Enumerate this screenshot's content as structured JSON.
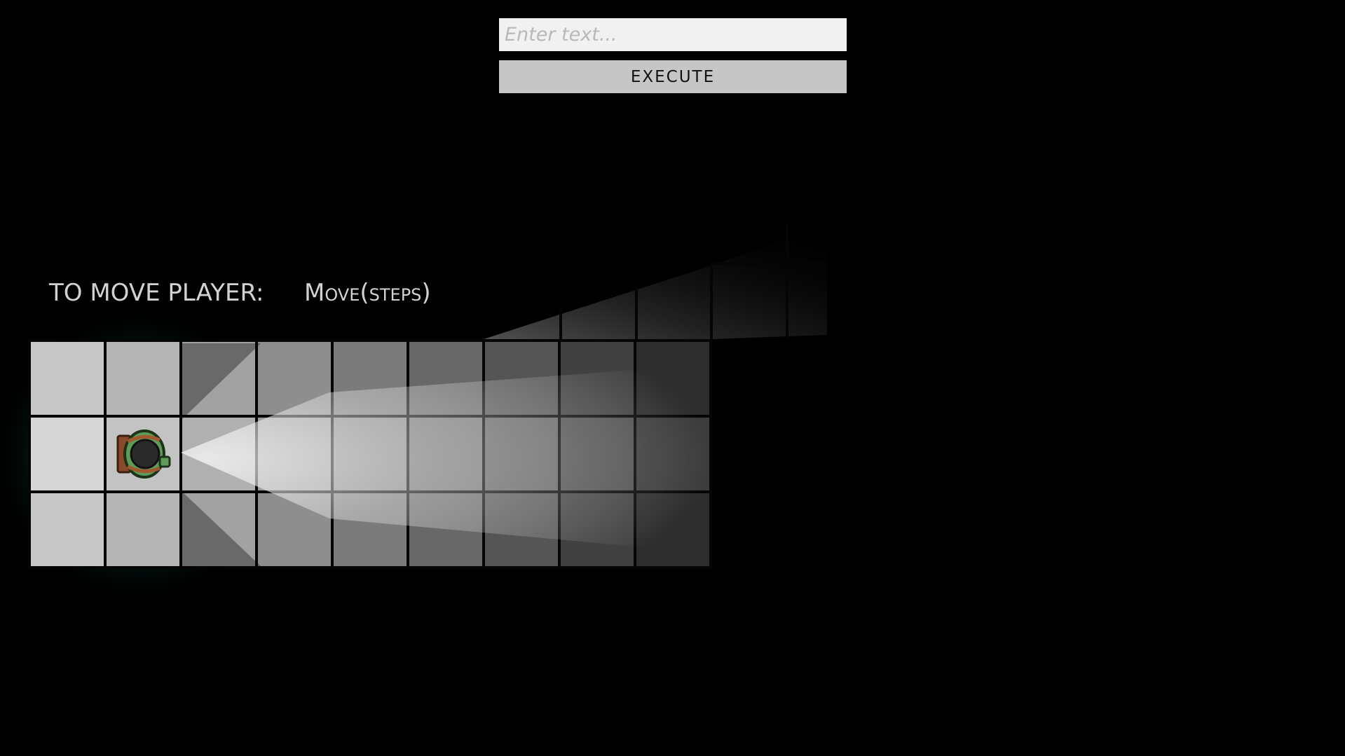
{
  "console": {
    "input_value": "",
    "input_placeholder": "Enter text...",
    "execute_label": "EXECUTE"
  },
  "instructions": {
    "label": "TO MOVE PLAYER:",
    "command": "Move(steps)"
  },
  "board": {
    "columns": 9,
    "rows": 3,
    "player": {
      "row": 1,
      "column": 1,
      "facing": "right"
    }
  },
  "colors": {
    "background": "#000000",
    "tile_bright": "#d9d9d9",
    "tile_dark": "#2f2f2f",
    "grid_line": "#050505",
    "glow": "#1e8a80",
    "player_body": "#5f9a58",
    "player_back": "#8a4a2a"
  },
  "icons": {
    "player": "player-topdown-icon"
  }
}
